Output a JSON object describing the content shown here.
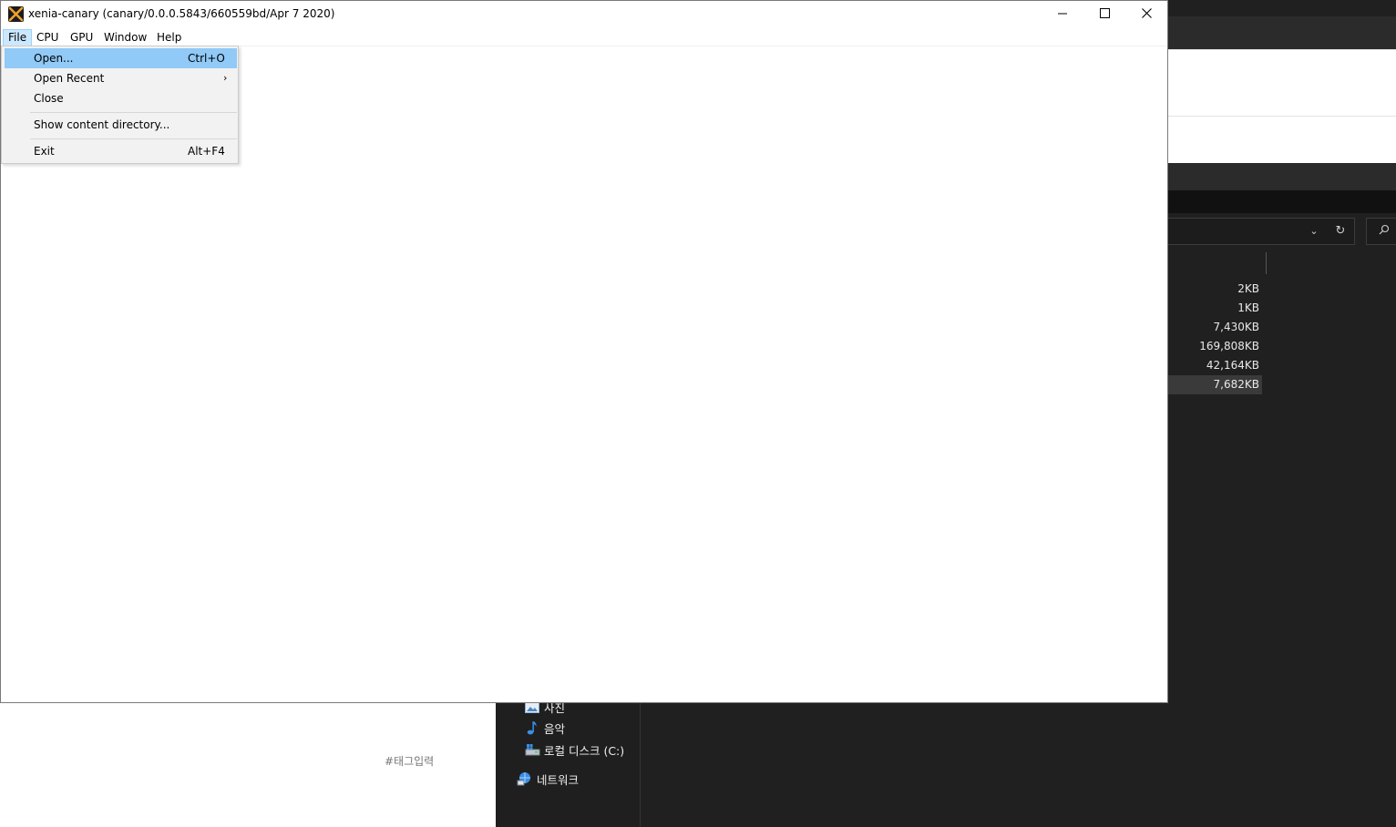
{
  "window": {
    "title": "xenia-canary (canary/0.0.0.5843/660559bd/Apr  7 2020)",
    "app_icon": "xenia-x-icon",
    "controls": {
      "minimize": "minimize-icon",
      "maximize": "maximize-icon",
      "close": "close-icon"
    }
  },
  "menubar": {
    "items": [
      {
        "label": "File",
        "active": true
      },
      {
        "label": "CPU"
      },
      {
        "label": "GPU"
      },
      {
        "label": "Window"
      },
      {
        "label": "Help"
      }
    ]
  },
  "file_menu": {
    "items": [
      {
        "label": "Open...",
        "shortcut": "Ctrl+O",
        "highlighted": true
      },
      {
        "label": "Open Recent",
        "submenu_arrow": "›"
      },
      {
        "label": "Close"
      },
      {
        "label": "Show content directory..."
      },
      {
        "label": "Exit",
        "shortcut": "Alt+F4"
      }
    ]
  },
  "background": {
    "explorer": {
      "file_sizes": [
        "2KB",
        "1KB",
        "7,430KB",
        "169,808KB",
        "42,164KB",
        "7,682KB"
      ],
      "selected_index": 5,
      "nav_items": [
        {
          "label": "사진",
          "icon": "pictures-icon"
        },
        {
          "label": "음악",
          "icon": "music-note-icon"
        },
        {
          "label": "로컬 디스크 (C:)",
          "icon": "local-disk-icon"
        },
        {
          "label": "네트워크",
          "icon": "network-icon"
        }
      ],
      "address_icons": {
        "dropdown": "chevron-down-icon",
        "refresh": "refresh-icon",
        "search": "search-icon"
      }
    },
    "tag_input": "#태그입력",
    "colors": {
      "dark_bg": "#202020",
      "menu_highlight": "#91c9f7",
      "menu_active": "#cce8ff"
    }
  }
}
